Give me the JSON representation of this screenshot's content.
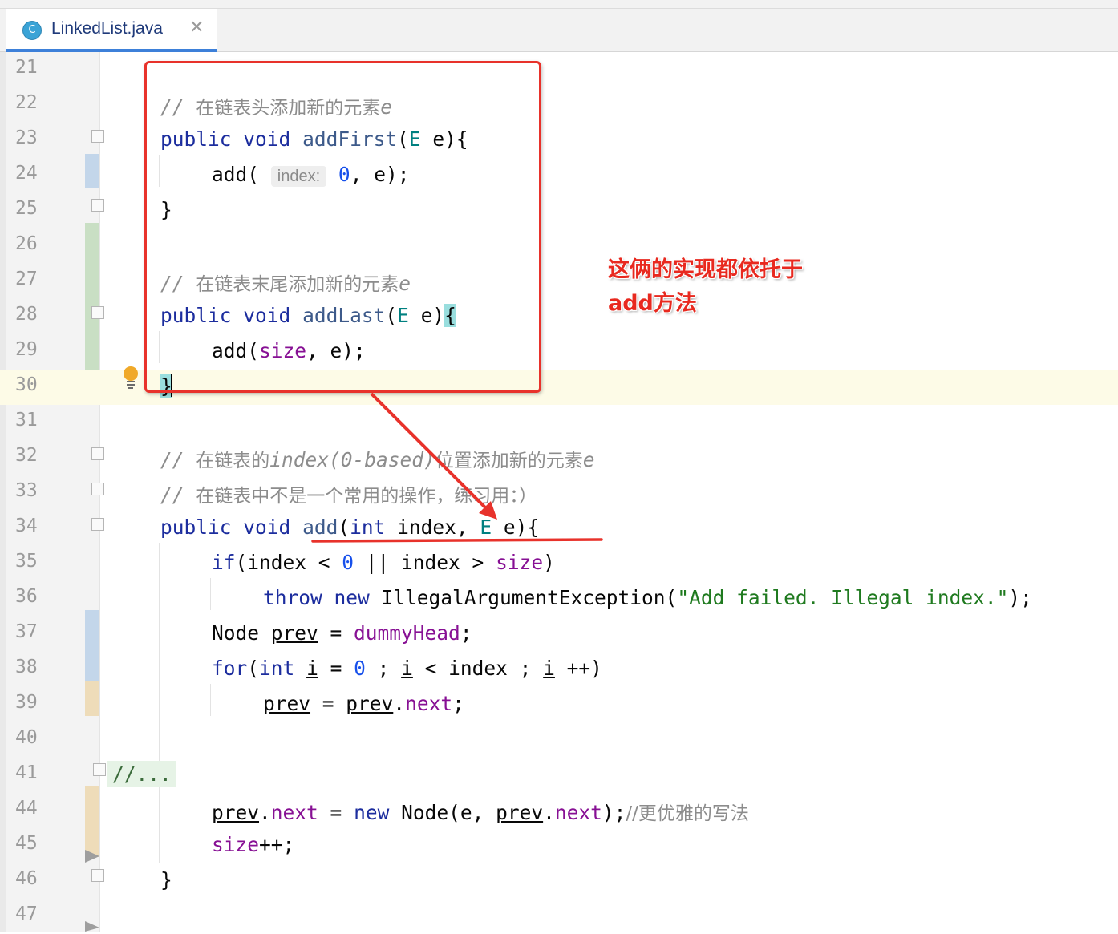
{
  "tab": {
    "icon_letter": "C",
    "filename": "LinkedList.java",
    "close_glyph": "✕"
  },
  "annotation": {
    "line1": "这俩的实现都依托于",
    "line2": "add方法"
  },
  "lines": {
    "n21": "21",
    "n22": "22",
    "n23": "23",
    "n24": "24",
    "n25": "25",
    "n26": "26",
    "n27": "27",
    "n28": "28",
    "n29": "29",
    "n30": "30",
    "n31": "31",
    "n32": "32",
    "n33": "33",
    "n34": "34",
    "n35": "35",
    "n36": "36",
    "n37": "37",
    "n38": "38",
    "n39": "39",
    "n40": "40",
    "n41": "41",
    "n44": "44",
    "n45": "45",
    "n46": "46",
    "n47": "47"
  },
  "code": {
    "c22_slash": "// ",
    "c22_zh": "在链表头添加新的元素",
    "c22_e": "e",
    "c23_pub": "public",
    "c23_void": "void",
    "c23_name": "addFirst",
    "c23_open": "(",
    "c23_E": "E",
    "c23_rest": " e){",
    "c24_call": "add(",
    "c24_hint": "index:",
    "c24_zero": "0",
    "c24_rest": ", e);",
    "c25": "}",
    "c27_slash": "// ",
    "c27_zh": "在链表末尾添加新的元素",
    "c27_e": "e",
    "c28_pub": "public",
    "c28_void": "void",
    "c28_name": "addLast",
    "c28_open": "(",
    "c28_E": "E",
    "c28_rest": " e)",
    "c28_brace": "{",
    "c29_call": "add(",
    "c29_size": "size",
    "c29_rest": ", e);",
    "c30": "}",
    "c32_slash": "// ",
    "c32_zh1": "在链表的",
    "c32_mid": "index(0-based)",
    "c32_zh2": "位置添加新的元素",
    "c32_e": "e",
    "c33_slash": "// ",
    "c33_zh": "在链表中不是一个常用的操作，练习用：）",
    "c34_pub": "public",
    "c34_void": "void",
    "c34_name": "add",
    "c34_open": "(",
    "c34_int": "int",
    "c34_idx": " index, ",
    "c34_E": "E",
    "c34_rest": " e){",
    "c35_if": "if",
    "c35_a": "(index < ",
    "c35_zero": "0",
    "c35_b": " || index > ",
    "c35_size": "size",
    "c35_c": ")",
    "c36_throw": "throw",
    "c36_new": "new",
    "c36_cls": " IllegalArgumentException(",
    "c36_str": "\"Add failed. Illegal index.\"",
    "c36_end": ");",
    "c37_node": "Node ",
    "c37_prev": "prev",
    "c37_eq": " = ",
    "c37_dummy": "dummyHead",
    "c37_end": ";",
    "c38_for": "for",
    "c38_open": "(",
    "c38_int": "int",
    "c38_i1": "i",
    "c38_eq": " = ",
    "c38_zero": "0",
    "c38_semi": " ; ",
    "c38_i2": "i",
    "c38_lt": " < index ; ",
    "c38_i3": "i",
    "c38_inc": " ++)",
    "c39_prev": "prev",
    "c39_eq": " = ",
    "c39_prev2": "prev",
    "c39_dot": ".",
    "c39_next": "next",
    "c39_end": ";",
    "c41_fold": "//...",
    "c44_prev": "prev",
    "c44_dot": ".",
    "c44_next": "next",
    "c44_eq": " = ",
    "c44_new": "new",
    "c44_node": " Node(e, ",
    "c44_prev2": "prev",
    "c44_dot2": ".",
    "c44_next2": "next",
    "c44_end": ");",
    "c44_cm": "//更优雅的写法",
    "c45_size": "size",
    "c45_end": "++;",
    "c46": "}"
  },
  "colors": {
    "keyword": "#1c2d9e",
    "comment": "#8c8c8c",
    "number": "#1750eb",
    "string": "#1f7a1f",
    "field": "#871094",
    "annotation_red": "#e8322b"
  }
}
